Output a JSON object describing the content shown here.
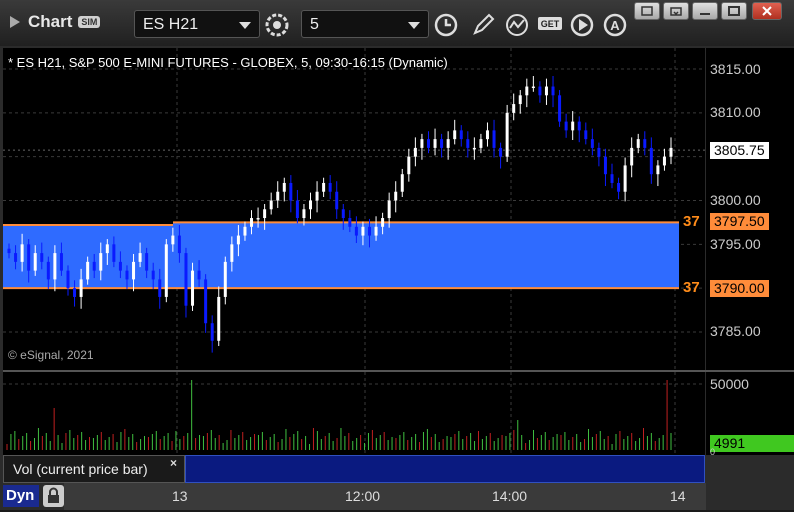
{
  "app": {
    "title": "Chart",
    "mode_badge": "SIM"
  },
  "toolbar": {
    "symbol": "ES H21",
    "interval": "5"
  },
  "chart": {
    "header": "* ES H21, S&P 500 E-MINI FUTURES - GLOBEX, 5, 09:30-16:15 (Dynamic)",
    "copyright": "© eSignal, 2021",
    "price_axis": [
      "3815.00",
      "3810.00",
      "3805.75",
      "3800.00",
      "3797.50",
      "3795.00",
      "3790.00",
      "3785.00"
    ],
    "current_price": "3805.75",
    "zone_top_price": "3797.50",
    "zone_bottom_price": "3790.00",
    "zone_top_count": "37",
    "zone_bottom_count": "37"
  },
  "volume": {
    "label": "Vol (current price bar)",
    "axis_top": "50000",
    "current": "4991",
    "axis_zero": "0"
  },
  "time_axis": [
    "13",
    "12:00",
    "14:00",
    "14"
  ],
  "bottom": {
    "dyn_label": "Dyn"
  },
  "colors": {
    "zone": "#2f6bff",
    "zone_border": "#ff8c3a",
    "up_candle": "#ffffff",
    "down_candle": "#0a1aff",
    "vol_up": "#40c040",
    "vol_down": "#c02020",
    "current_tag": "#40c820"
  }
}
